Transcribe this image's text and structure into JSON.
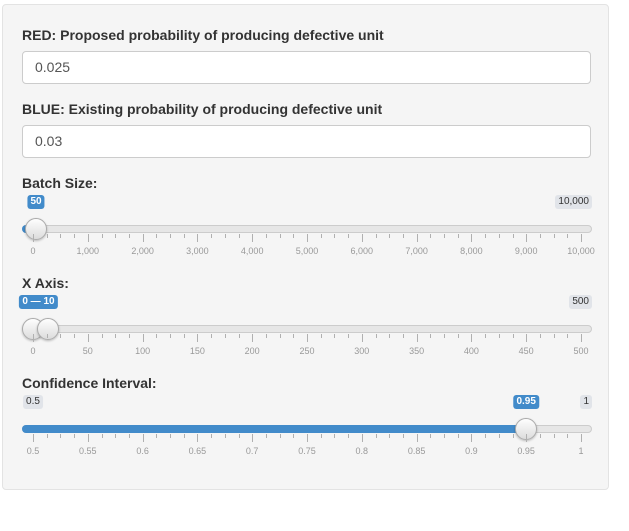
{
  "fields": {
    "red": {
      "label": "RED: Proposed probability of producing defective unit",
      "value": "0.025"
    },
    "blue": {
      "label": "BLUE: Existing probability of producing defective unit",
      "value": "0.03"
    }
  },
  "sliders": {
    "batch": {
      "label": "Batch Size:",
      "min_label": "",
      "max_label": "10,000",
      "value_label": "50",
      "value_fraction": 0.005,
      "ticks": [
        "0",
        "1,000",
        "2,000",
        "3,000",
        "4,000",
        "5,000",
        "6,000",
        "7,000",
        "8,000",
        "9,000",
        "10,000"
      ]
    },
    "xaxis": {
      "label": "X Axis:",
      "min_label": "",
      "max_label": "500",
      "value_label": "0 — 10",
      "range_fraction": [
        0,
        0.02
      ],
      "ticks": [
        "0",
        "50",
        "100",
        "150",
        "200",
        "250",
        "300",
        "350",
        "400",
        "450",
        "500"
      ]
    },
    "ci": {
      "label": "Confidence Interval:",
      "min_label": "0.5",
      "max_label": "1",
      "value_label": "0.95",
      "value_fraction": 0.9,
      "ticks": [
        "0.5",
        "0.55",
        "0.6",
        "0.65",
        "0.7",
        "0.75",
        "0.8",
        "0.85",
        "0.9",
        "0.95",
        "1"
      ]
    }
  },
  "colors": {
    "accent": "#428bca"
  }
}
